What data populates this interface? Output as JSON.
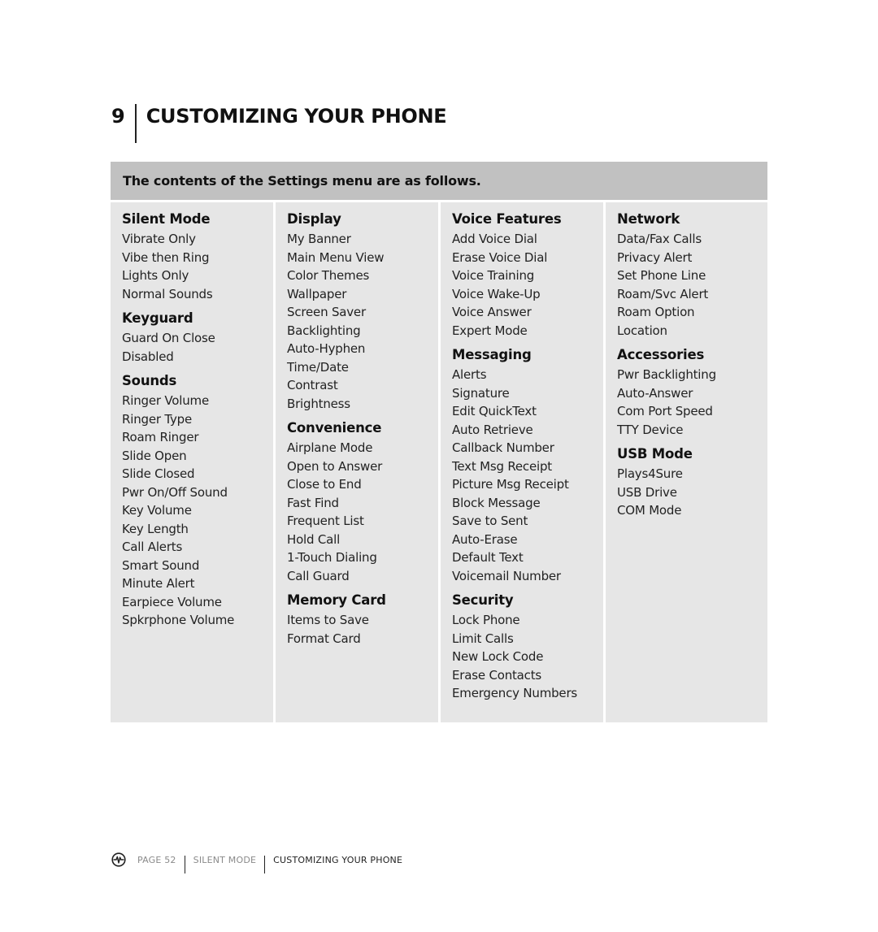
{
  "chapter": {
    "number": "9",
    "title": "CUSTOMIZING YOUR PHONE"
  },
  "table": {
    "heading": "The contents of the Settings menu are as follows.",
    "columns": [
      {
        "sections": [
          {
            "title": "Silent Mode",
            "items": [
              "Vibrate Only",
              "Vibe then Ring",
              "Lights Only",
              "Normal Sounds"
            ]
          },
          {
            "title": "Keyguard",
            "items": [
              "Guard On Close",
              "Disabled"
            ]
          },
          {
            "title": "Sounds",
            "items": [
              "Ringer Volume",
              "Ringer Type",
              "Roam Ringer",
              "Slide Open",
              "Slide Closed",
              "Pwr On/Off Sound",
              "Key Volume",
              "Key Length",
              "Call Alerts",
              "Smart Sound",
              "Minute Alert",
              "Earpiece Volume",
              "Spkrphone Volume"
            ]
          }
        ]
      },
      {
        "sections": [
          {
            "title": "Display",
            "items": [
              "My Banner",
              "Main Menu View",
              "Color Themes",
              "Wallpaper",
              "Screen Saver",
              "Backlighting",
              "Auto-Hyphen",
              "Time/Date",
              "Contrast",
              "Brightness"
            ]
          },
          {
            "title": "Convenience",
            "items": [
              "Airplane Mode",
              "Open to Answer",
              "Close to End",
              "Fast Find",
              "Frequent List",
              "Hold Call",
              "1-Touch Dialing",
              "Call Guard"
            ]
          },
          {
            "title": "Memory Card",
            "items": [
              "Items to Save",
              "Format Card"
            ]
          }
        ]
      },
      {
        "sections": [
          {
            "title": "Voice Features",
            "items": [
              "Add Voice Dial",
              "Erase Voice Dial",
              "Voice Training",
              "Voice Wake-Up",
              "Voice Answer",
              "Expert Mode"
            ]
          },
          {
            "title": "Messaging",
            "items": [
              "Alerts",
              "Signature",
              "Edit QuickText",
              "Auto Retrieve",
              "Callback Number",
              "Text Msg Receipt",
              "Picture Msg Receipt",
              "Block Message",
              "Save to Sent",
              "Auto-Erase",
              "Default Text",
              "Voicemail Number"
            ]
          },
          {
            "title": "Security",
            "items": [
              "Lock Phone",
              "Limit Calls",
              "New Lock Code",
              "Erase Contacts",
              "Emergency Numbers"
            ]
          }
        ]
      },
      {
        "sections": [
          {
            "title": "Network",
            "items": [
              "Data/Fax Calls",
              "Privacy Alert",
              "Set Phone Line",
              "Roam/Svc Alert",
              "Roam Option",
              "Location"
            ]
          },
          {
            "title": "Accessories",
            "items": [
              "Pwr Backlighting",
              "Auto-Answer",
              "Com Port Speed",
              "TTY Device"
            ]
          },
          {
            "title": "USB Mode",
            "items": [
              "Plays4Sure",
              "USB Drive",
              "COM Mode"
            ]
          }
        ]
      }
    ]
  },
  "footer": {
    "icon": "waveform-circle-icon",
    "page": "PAGE 52",
    "section": "SILENT MODE",
    "chapter": "CUSTOMIZING YOUR PHONE"
  },
  "colors": {
    "header_band": "#c1c1c1",
    "cell_bg": "#e6e6e6",
    "footer_muted": "#8a8a8a"
  }
}
